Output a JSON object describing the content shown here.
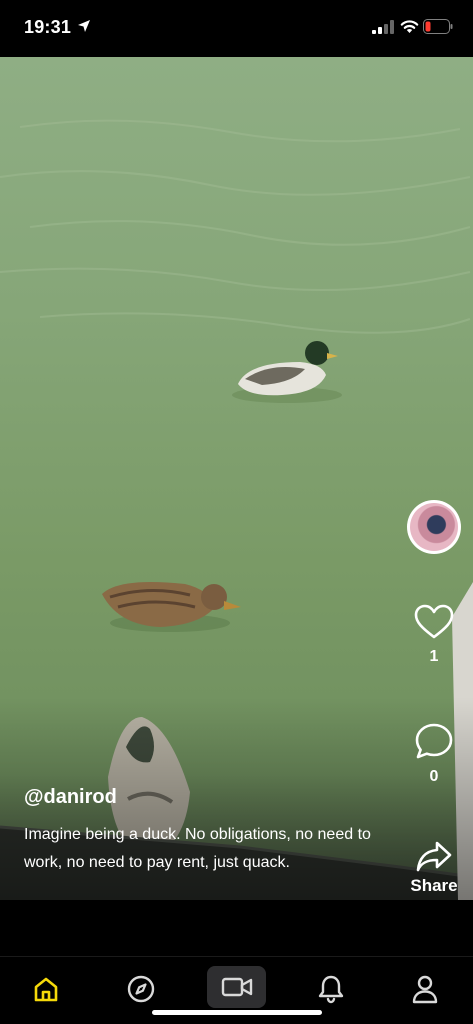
{
  "status_bar": {
    "time": "19:31"
  },
  "post": {
    "username": "@danirod",
    "caption": "Imagine being a duck. No obligations, no need to work, no need to pay rent, just quack.",
    "likes": "1",
    "comments": "0",
    "share_label": "Share"
  },
  "icons": {
    "location": "location-arrow-icon",
    "signal": "cellular-signal-icon",
    "wifi": "wifi-icon",
    "battery": "battery-low-icon",
    "like": "heart-icon",
    "comment": "comment-bubble-icon",
    "share": "share-arrow-icon",
    "home": "home-icon",
    "explore": "compass-icon",
    "record": "video-camera-icon",
    "notifications": "bell-icon",
    "profile": "person-icon"
  },
  "colors": {
    "accent": "#f5d90a",
    "battery_low": "#ff3b30",
    "water": "#86a678"
  }
}
